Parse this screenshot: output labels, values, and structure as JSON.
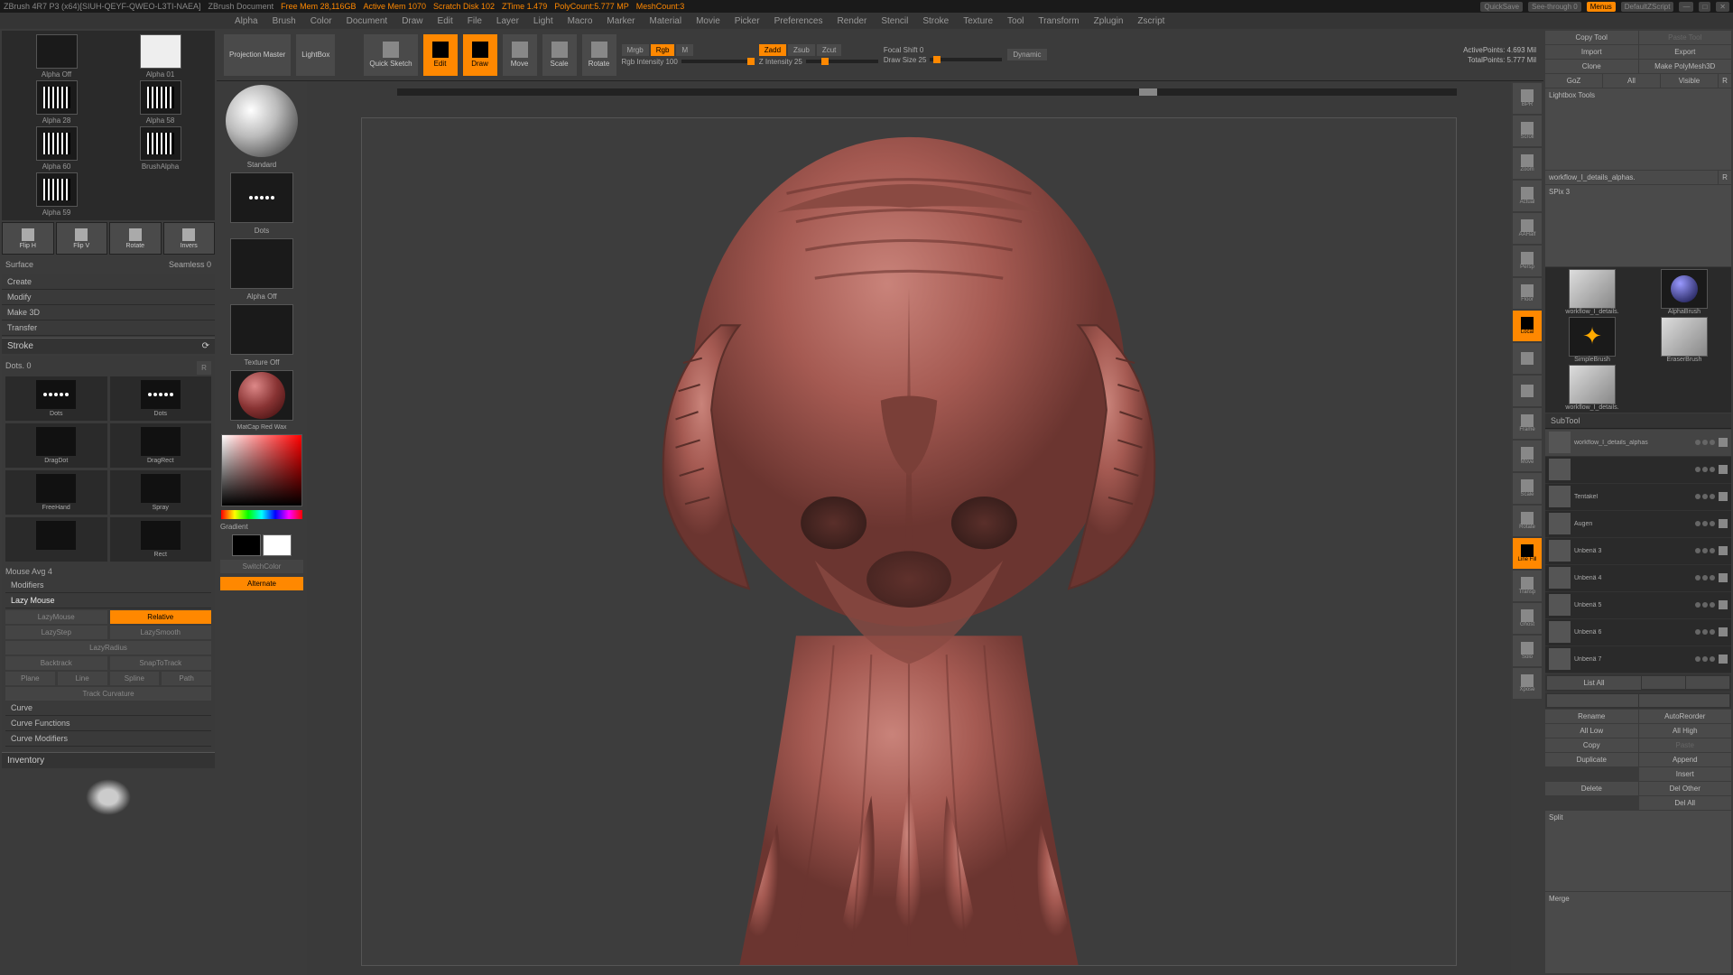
{
  "titlebar": {
    "app": "ZBrush 4R7 P3 (x64)[SIUH-QEYF-QWEO-L3TI-NAEA]",
    "doc": "ZBrush Document",
    "freemem": "Free Mem 28,116GB",
    "activemem": "Active Mem 1070",
    "scratch": "Scratch Disk 102",
    "ztime": "ZTime 1.479",
    "polycount": "PolyCount:5.777 MP",
    "meshcount": "MeshCount:3",
    "quicksave": "QuickSave",
    "seethrough": "See-through  0",
    "menus": "Menus",
    "script": "DefaultZScript"
  },
  "menu": [
    "Alpha",
    "Brush",
    "Color",
    "Document",
    "Draw",
    "Edit",
    "File",
    "Layer",
    "Light",
    "Macro",
    "Marker",
    "Material",
    "Movie",
    "Picker",
    "Preferences",
    "Render",
    "Stencil",
    "Stroke",
    "Texture",
    "Tool",
    "Transform",
    "Zplugin",
    "Zscript"
  ],
  "alphas": [
    {
      "label": "Alpha Off",
      "white": false
    },
    {
      "label": "Alpha 01",
      "white": true,
      "lines": false
    },
    {
      "label": "Alpha 28",
      "white": false,
      "lines": true
    },
    {
      "label": "Alpha 58",
      "white": false,
      "lines": true
    },
    {
      "label": "Alpha 60",
      "white": false,
      "lines": true
    },
    {
      "label": "BrushAlpha",
      "white": false,
      "lines": true
    },
    {
      "label": "Alpha 59",
      "white": false,
      "lines": true
    }
  ],
  "actions": [
    "Flip H",
    "Flip V",
    "Rotate",
    "Invers"
  ],
  "surface": {
    "label": "Surface",
    "seamless": "Seamless 0"
  },
  "listbtns": [
    "Create",
    "Modify",
    "Make 3D",
    "Transfer"
  ],
  "stroke": {
    "head": "Stroke",
    "dots": "Dots. 0",
    "r": "R",
    "types": [
      "Dots",
      "Dots",
      "DragDot",
      "DragRect",
      "FreeHand",
      "Spray",
      "",
      "Rect"
    ],
    "mouseavg": "Mouse Avg 4",
    "modifiers": "Modifiers",
    "lazy": "Lazy Mouse",
    "lazymouse": "LazyMouse",
    "relative": "Relative",
    "lazystep": "LazyStep",
    "lazysmooth": "LazySmooth",
    "lazyradius": "LazyRadius",
    "backtrack": "Backtrack",
    "snaptrack": "SnapToTrack",
    "trackline": [
      "Plane",
      "Line",
      "Spline",
      "Path"
    ],
    "trackcurv": "Track Curvature",
    "curve": "Curve",
    "curvefn": "Curve Functions",
    "curvemod": "Curve Modifiers",
    "inventory": "Inventory"
  },
  "brushcol": {
    "standard": "Standard",
    "dots": "Dots",
    "alphaoff": "Alpha Off",
    "textureoff": "Texture Off",
    "matcap": "MatCap Red Wax",
    "gradient": "Gradient",
    "switchcolor": "SwitchColor",
    "alternate": "Alternate"
  },
  "topbar": {
    "projmaster": "Projection Master",
    "lightbox": "LightBox",
    "quicksketch": "Quick Sketch",
    "edit": "Edit",
    "draw": "Draw",
    "move": "Move",
    "scale": "Scale",
    "rotate": "Rotate",
    "mrgb": "Mrgb",
    "rgb": "Rgb",
    "m": "M",
    "rgbintensity": "Rgb Intensity 100",
    "zadd": "Zadd",
    "zsub": "Zsub",
    "zcut": "Zcut",
    "zintensity": "Z Intensity 25",
    "focalshift": "Focal Shift 0",
    "drawsize": "Draw Size 25",
    "dynamic": "Dynamic"
  },
  "stats": {
    "active": "ActivePoints: 4.693 Mil",
    "total": "TotalPoints: 5.777 Mil"
  },
  "sidetools": [
    "BPR",
    "Scroll",
    "Zoom",
    "Actual",
    "AAHalf",
    "Persp",
    "Floor",
    "Local",
    "",
    "",
    "Frame",
    "Move",
    "Scale",
    "Rotate",
    "Line Fill",
    "Transp",
    "Ghost",
    "Solo",
    "Xpose"
  ],
  "rp": {
    "copytool": "Copy Tool",
    "pastetool": "Paste Tool",
    "import": "Import",
    "export": "Export",
    "clone": "Clone",
    "makepoly": "Make PolyMesh3D",
    "goz": "GoZ",
    "all": "All",
    "visible": "Visible",
    "r": "R",
    "lbtools": "Lightbox Tools",
    "toolname": "workflow_I_details_alphas.",
    "spix": "SPix 3",
    "tools": [
      {
        "name": "workflow_I_details."
      },
      {
        "name": "AlphaBrush"
      },
      {
        "name": "SimpleBrush"
      },
      {
        "name": "EraserBrush"
      },
      {
        "name": "workflow_I_details."
      }
    ],
    "subtool": "SubTool",
    "subtools": [
      {
        "name": "workflow_I_details_alphas",
        "sel": true
      },
      {
        "name": ""
      },
      {
        "name": "Tentakel"
      },
      {
        "name": "Augen"
      },
      {
        "name": "Unbenä 3"
      },
      {
        "name": "Unbenä 4"
      },
      {
        "name": "Unbenä 5"
      },
      {
        "name": "Unbenä 6"
      },
      {
        "name": "Unbenä 7"
      }
    ],
    "listall": "List All",
    "rename": "Rename",
    "autoreorder": "AutoReorder",
    "alllow": "All Low",
    "allhigh": "All High",
    "copy": "Copy",
    "paste": "Paste",
    "duplicate": "Duplicate",
    "append": "Append",
    "insert": "Insert",
    "delete": "Delete",
    "delother": "Del Other",
    "delall": "Del All",
    "split": "Split",
    "merge": "Merge"
  }
}
